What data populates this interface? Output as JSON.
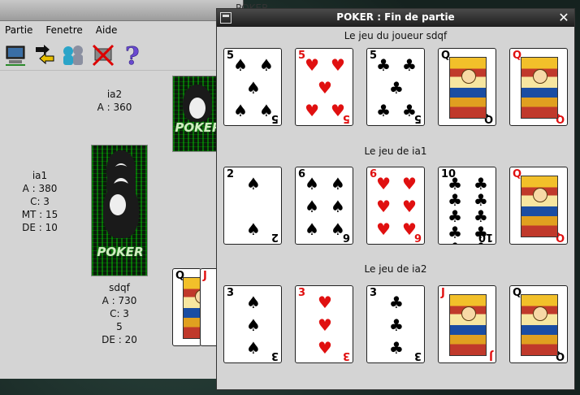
{
  "main_window": {
    "title": "POKER",
    "menu": [
      {
        "label": "Partie"
      },
      {
        "label": "Fenetre"
      },
      {
        "label": "Aide"
      }
    ],
    "toolbar_icons": [
      "computer-icon",
      "swap-arrows-icon",
      "players-icon",
      "network-error-icon",
      "help-icon"
    ],
    "players": {
      "ia2": {
        "name": "ia2",
        "line1": "A : 360"
      },
      "ia1": {
        "name": "ia1",
        "line1": "A : 380",
        "line2": "C: 3",
        "line3": "MT : 15",
        "line4": "DE : 10"
      },
      "sdqf": {
        "name": "sdqf",
        "line1": "A : 730",
        "line2": "C: 3",
        "line3": "5",
        "line4": "DE : 20"
      }
    },
    "card_back_text": "POKER"
  },
  "dialog": {
    "title": "POKER : Fin de partie",
    "close_glyph": "✕",
    "hands": [
      {
        "label": "Le jeu du joueur sdqf",
        "cards": [
          {
            "rank": "5",
            "suit": "♠",
            "color": "black"
          },
          {
            "rank": "5",
            "suit": "♥",
            "color": "red"
          },
          {
            "rank": "5",
            "suit": "♣",
            "color": "black"
          },
          {
            "rank": "Q",
            "suit": "♠",
            "color": "black"
          },
          {
            "rank": "Q",
            "suit": "♦",
            "color": "red"
          }
        ]
      },
      {
        "label": "Le jeu de ia1",
        "cards": [
          {
            "rank": "2",
            "suit": "♠",
            "color": "black"
          },
          {
            "rank": "6",
            "suit": "♠",
            "color": "black"
          },
          {
            "rank": "6",
            "suit": "♥",
            "color": "red"
          },
          {
            "rank": "10",
            "suit": "♣",
            "color": "black"
          },
          {
            "rank": "Q",
            "suit": "♥",
            "color": "red"
          }
        ]
      },
      {
        "label": "Le jeu de ia2",
        "cards": [
          {
            "rank": "3",
            "suit": "♠",
            "color": "black"
          },
          {
            "rank": "3",
            "suit": "♥",
            "color": "red"
          },
          {
            "rank": "3",
            "suit": "♣",
            "color": "black"
          },
          {
            "rank": "J",
            "suit": "♦",
            "color": "red"
          },
          {
            "rank": "Q",
            "suit": "♣",
            "color": "black"
          }
        ]
      }
    ]
  },
  "colors": {
    "red_suit": "#e01010",
    "black_suit": "#000000",
    "dialog_titlebar": "#1e1e1e",
    "window_bg": "#d4d4d4"
  }
}
